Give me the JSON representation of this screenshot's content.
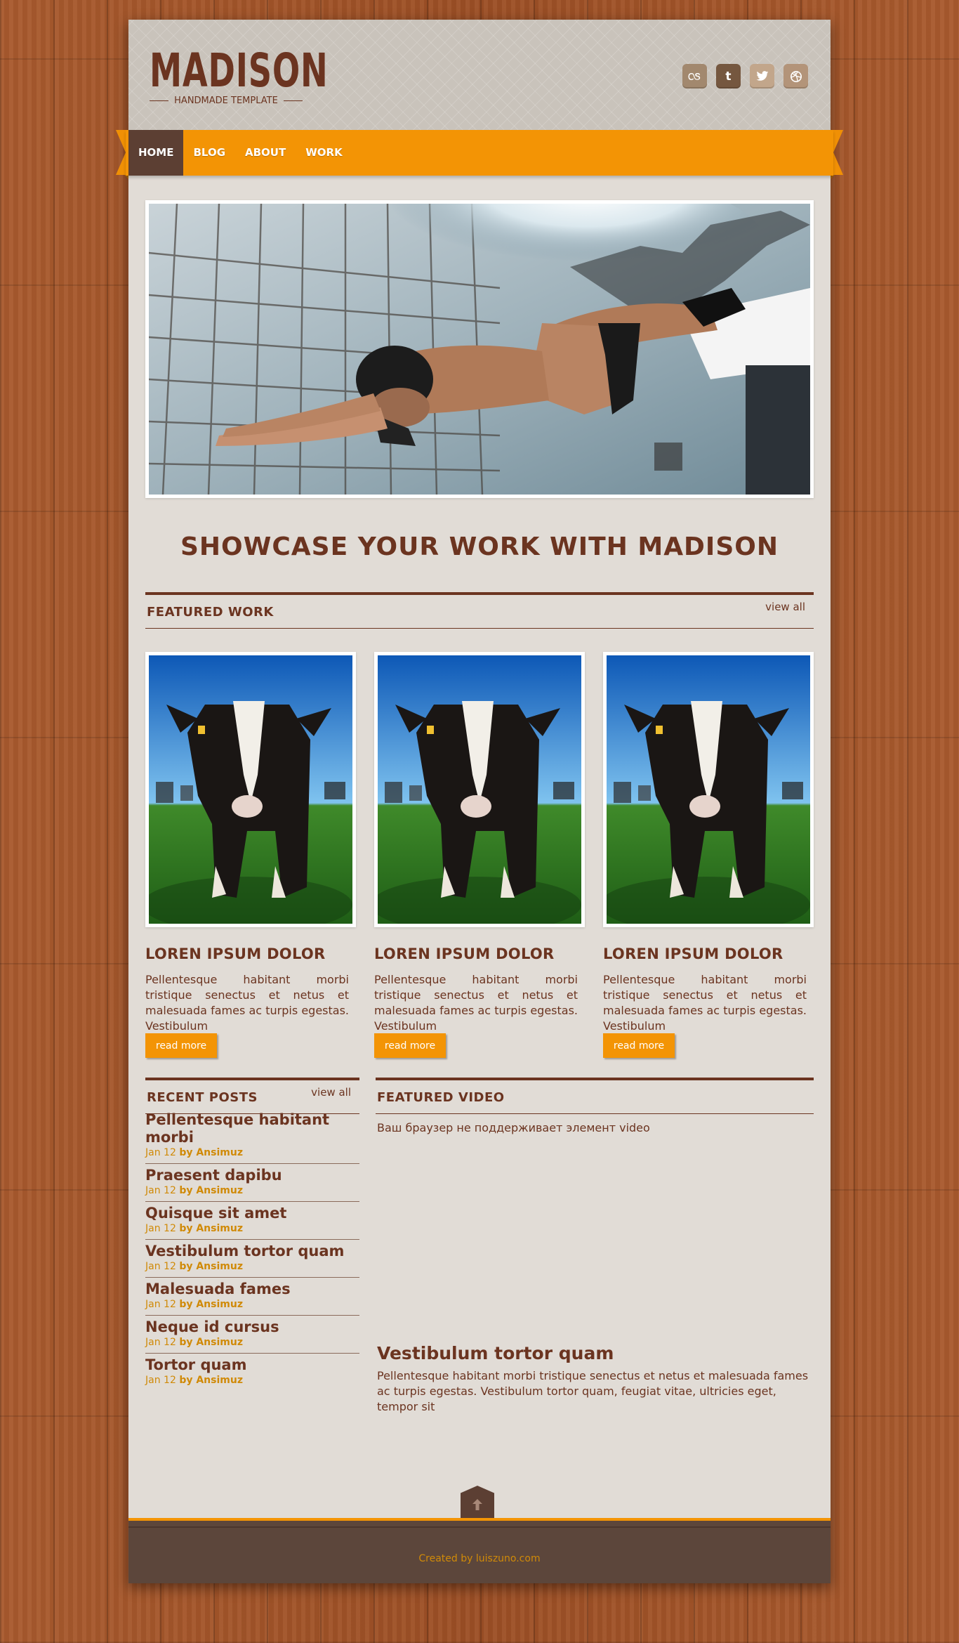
{
  "header": {
    "logo_title": "MADISON",
    "logo_subtitle": "HANDMADE TEMPLATE",
    "social": [
      {
        "icon": "lastfm-icon",
        "glyph": "ꗞ",
        "color": "#a2886e"
      },
      {
        "icon": "tumblr-icon",
        "glyph": "t",
        "color": "#75573f"
      },
      {
        "icon": "twitter-icon",
        "glyph": "🐦",
        "color": "#c2a68b"
      },
      {
        "icon": "dribbble-icon",
        "glyph": "⊛",
        "color": "#b39479"
      }
    ]
  },
  "nav": {
    "items": [
      {
        "label": "HOME",
        "active": true
      },
      {
        "label": "BLOG",
        "active": false
      },
      {
        "label": "ABOUT",
        "active": false
      },
      {
        "label": "WORK",
        "active": false
      }
    ]
  },
  "showcase_heading": "SHOWCASE YOUR WORK WITH MADISON",
  "featured_work": {
    "title": "FEATURED WORK",
    "view_all": "view all",
    "cards": [
      {
        "title": "LOREN IPSUM DOLOR",
        "text": "Pellentesque habitant morbi tristique senectus et netus et malesuada fames ac turpis egestas. Vestibulum",
        "button": "read more"
      },
      {
        "title": "LOREN IPSUM DOLOR",
        "text": "Pellentesque habitant morbi tristique senectus et netus et malesuada fames ac turpis egestas. Vestibulum",
        "button": "read more"
      },
      {
        "title": "LOREN IPSUM DOLOR",
        "text": "Pellentesque habitant morbi tristique senectus et netus et malesuada fames ac turpis egestas. Vestibulum",
        "button": "read more"
      }
    ]
  },
  "recent_posts": {
    "title": "RECENT POSTS",
    "view_all": "view all",
    "posts": [
      {
        "title": "Pellentesque habitant morbi",
        "date": "Jan 12",
        "author": "by Ansimuz"
      },
      {
        "title": "Praesent dapibu",
        "date": "Jan 12",
        "author": "by Ansimuz"
      },
      {
        "title": "Quisque sit amet",
        "date": "Jan 12",
        "author": "by Ansimuz"
      },
      {
        "title": "Vestibulum tortor quam",
        "date": "Jan 12",
        "author": "by Ansimuz"
      },
      {
        "title": "Malesuada fames",
        "date": "Jan 12",
        "author": "by Ansimuz"
      },
      {
        "title": "Neque id cursus",
        "date": "Jan 12",
        "author": "by Ansimuz"
      },
      {
        "title": "Tortor quam",
        "date": "Jan 12",
        "author": "by Ansimuz"
      }
    ]
  },
  "featured_video": {
    "title": "FEATURED VIDEO",
    "unsupported_message": "Ваш браузер не поддерживает элемент video",
    "video_title": "Vestibulum tortor quam",
    "video_text": "Pellentesque habitant morbi tristique senectus et netus et malesuada fames ac turpis egestas. Vestibulum tortor quam, feugiat vitae, ultricies eget, tempor sit"
  },
  "footer": {
    "credit": "Created by luiszuno.com",
    "to_top_icon": "arrow-up-icon"
  },
  "colors": {
    "brown": "#6b3420",
    "orange": "#f39405",
    "dark_brown": "#5c3f33",
    "page_bg": "#e1dcd6"
  }
}
